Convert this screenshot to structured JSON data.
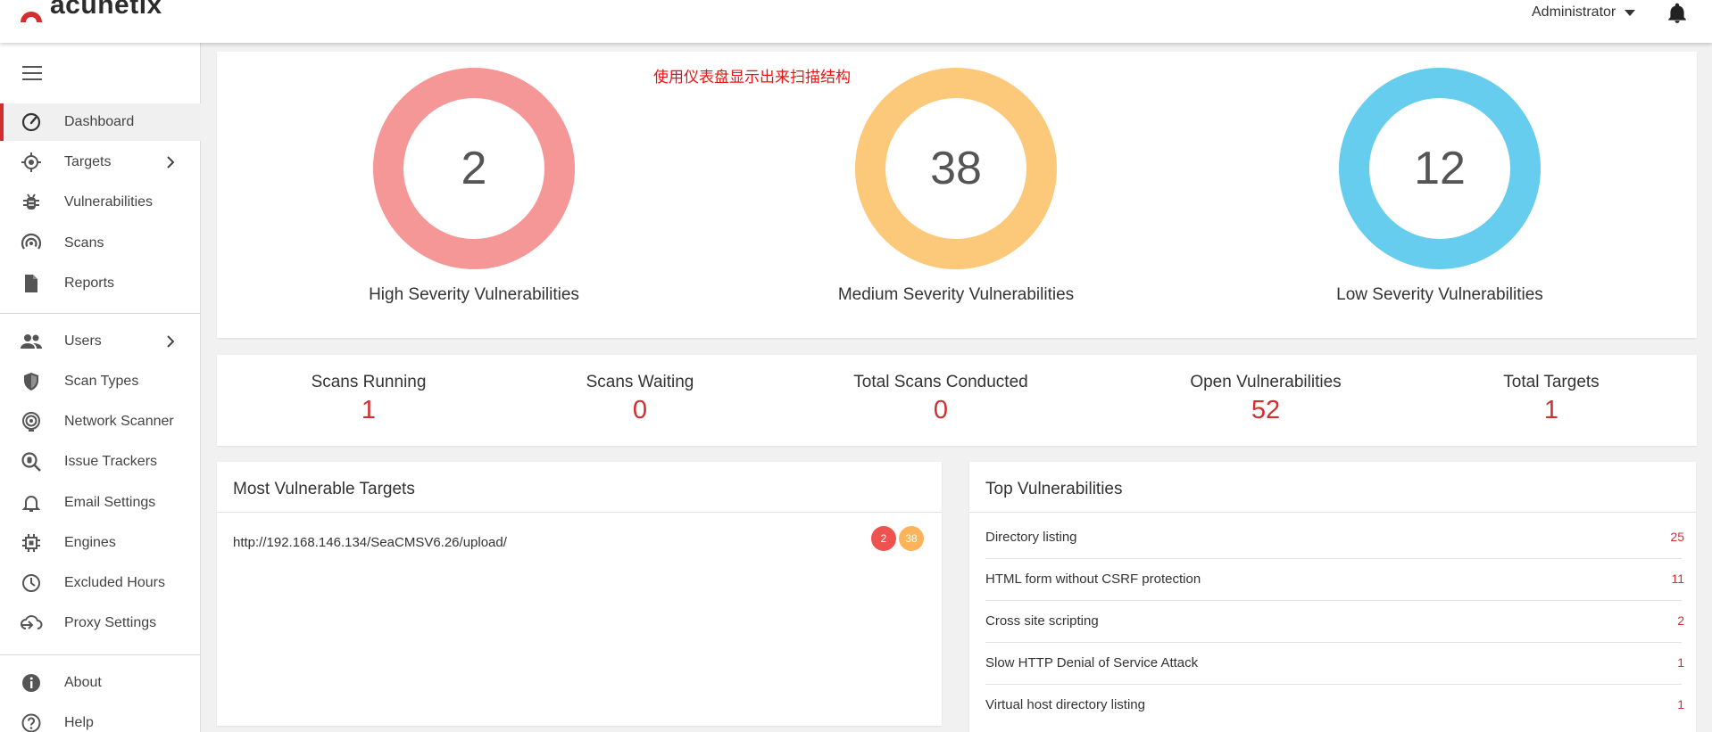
{
  "header": {
    "brand": "acunetix",
    "user": "Administrator",
    "accent_color": "#d32f2f"
  },
  "sidebar": {
    "items": [
      {
        "label": "Dashboard",
        "icon": "dashboard-gauge-icon",
        "active": true
      },
      {
        "label": "Targets",
        "icon": "crosshair-target-icon",
        "chevron": true
      },
      {
        "label": "Vulnerabilities",
        "icon": "bug-icon"
      },
      {
        "label": "Scans",
        "icon": "radar-scan-icon"
      },
      {
        "label": "Reports",
        "icon": "document-icon"
      },
      {
        "label": "Users",
        "icon": "users-icon",
        "chevron": true
      },
      {
        "label": "Scan Types",
        "icon": "shield-icon"
      },
      {
        "label": "Network Scanner",
        "icon": "network-scanner-icon"
      },
      {
        "label": "Issue Trackers",
        "icon": "issue-tracker-icon"
      },
      {
        "label": "Email Settings",
        "icon": "bell-icon"
      },
      {
        "label": "Engines",
        "icon": "chip-icon"
      },
      {
        "label": "Excluded Hours",
        "icon": "clock-icon"
      },
      {
        "label": "Proxy Settings",
        "icon": "cloud-proxy-icon"
      },
      {
        "label": "About",
        "icon": "info-icon"
      },
      {
        "label": "Help",
        "icon": "help-icon"
      }
    ]
  },
  "annotation": "使用仪表盘显示出来扫描结构",
  "severity": [
    {
      "value": "2",
      "label": "High Severity Vulnerabilities",
      "color": "#f59797"
    },
    {
      "value": "38",
      "label": "Medium Severity Vulnerabilities",
      "color": "#fcc87a"
    },
    {
      "value": "12",
      "label": "Low Severity Vulnerabilities",
      "color": "#66cdee"
    }
  ],
  "stats": [
    {
      "label": "Scans Running",
      "value": "1"
    },
    {
      "label": "Scans Waiting",
      "value": "0"
    },
    {
      "label": "Total Scans Conducted",
      "value": "0"
    },
    {
      "label": "Open Vulnerabilities",
      "value": "52"
    },
    {
      "label": "Total Targets",
      "value": "1"
    }
  ],
  "most_vulnerable": {
    "title": "Most Vulnerable Targets",
    "rows": [
      {
        "url": "http://192.168.146.134/SeaCMSV6.26/upload/",
        "high": "2",
        "medium": "38"
      }
    ],
    "high_color": "#ef5350",
    "medium_color": "#fbb45a"
  },
  "top_vulnerabilities": {
    "title": "Top Vulnerabilities",
    "rows": [
      {
        "name": "Directory listing",
        "count": "25"
      },
      {
        "name": "HTML form without CSRF protection",
        "count": "11"
      },
      {
        "name": "Cross site scripting",
        "count": "2"
      },
      {
        "name": "Slow HTTP Denial of Service Attack",
        "count": "1"
      },
      {
        "name": "Virtual host directory listing",
        "count": "1"
      }
    ]
  }
}
